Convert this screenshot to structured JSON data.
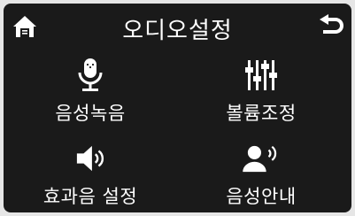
{
  "header": {
    "title": "오디오설정",
    "home_icon": "home-icon",
    "back_icon": "back-arrow-icon"
  },
  "menu": [
    {
      "label": "음성녹음",
      "icon": "microphone-icon"
    },
    {
      "label": "볼륨조정",
      "icon": "equalizer-sliders-icon"
    },
    {
      "label": "효과음 설정",
      "icon": "speaker-icon"
    },
    {
      "label": "음성안내",
      "icon": "voice-guide-person-icon"
    }
  ],
  "colors": {
    "background": "#1a1a1a",
    "foreground": "#ffffff"
  }
}
